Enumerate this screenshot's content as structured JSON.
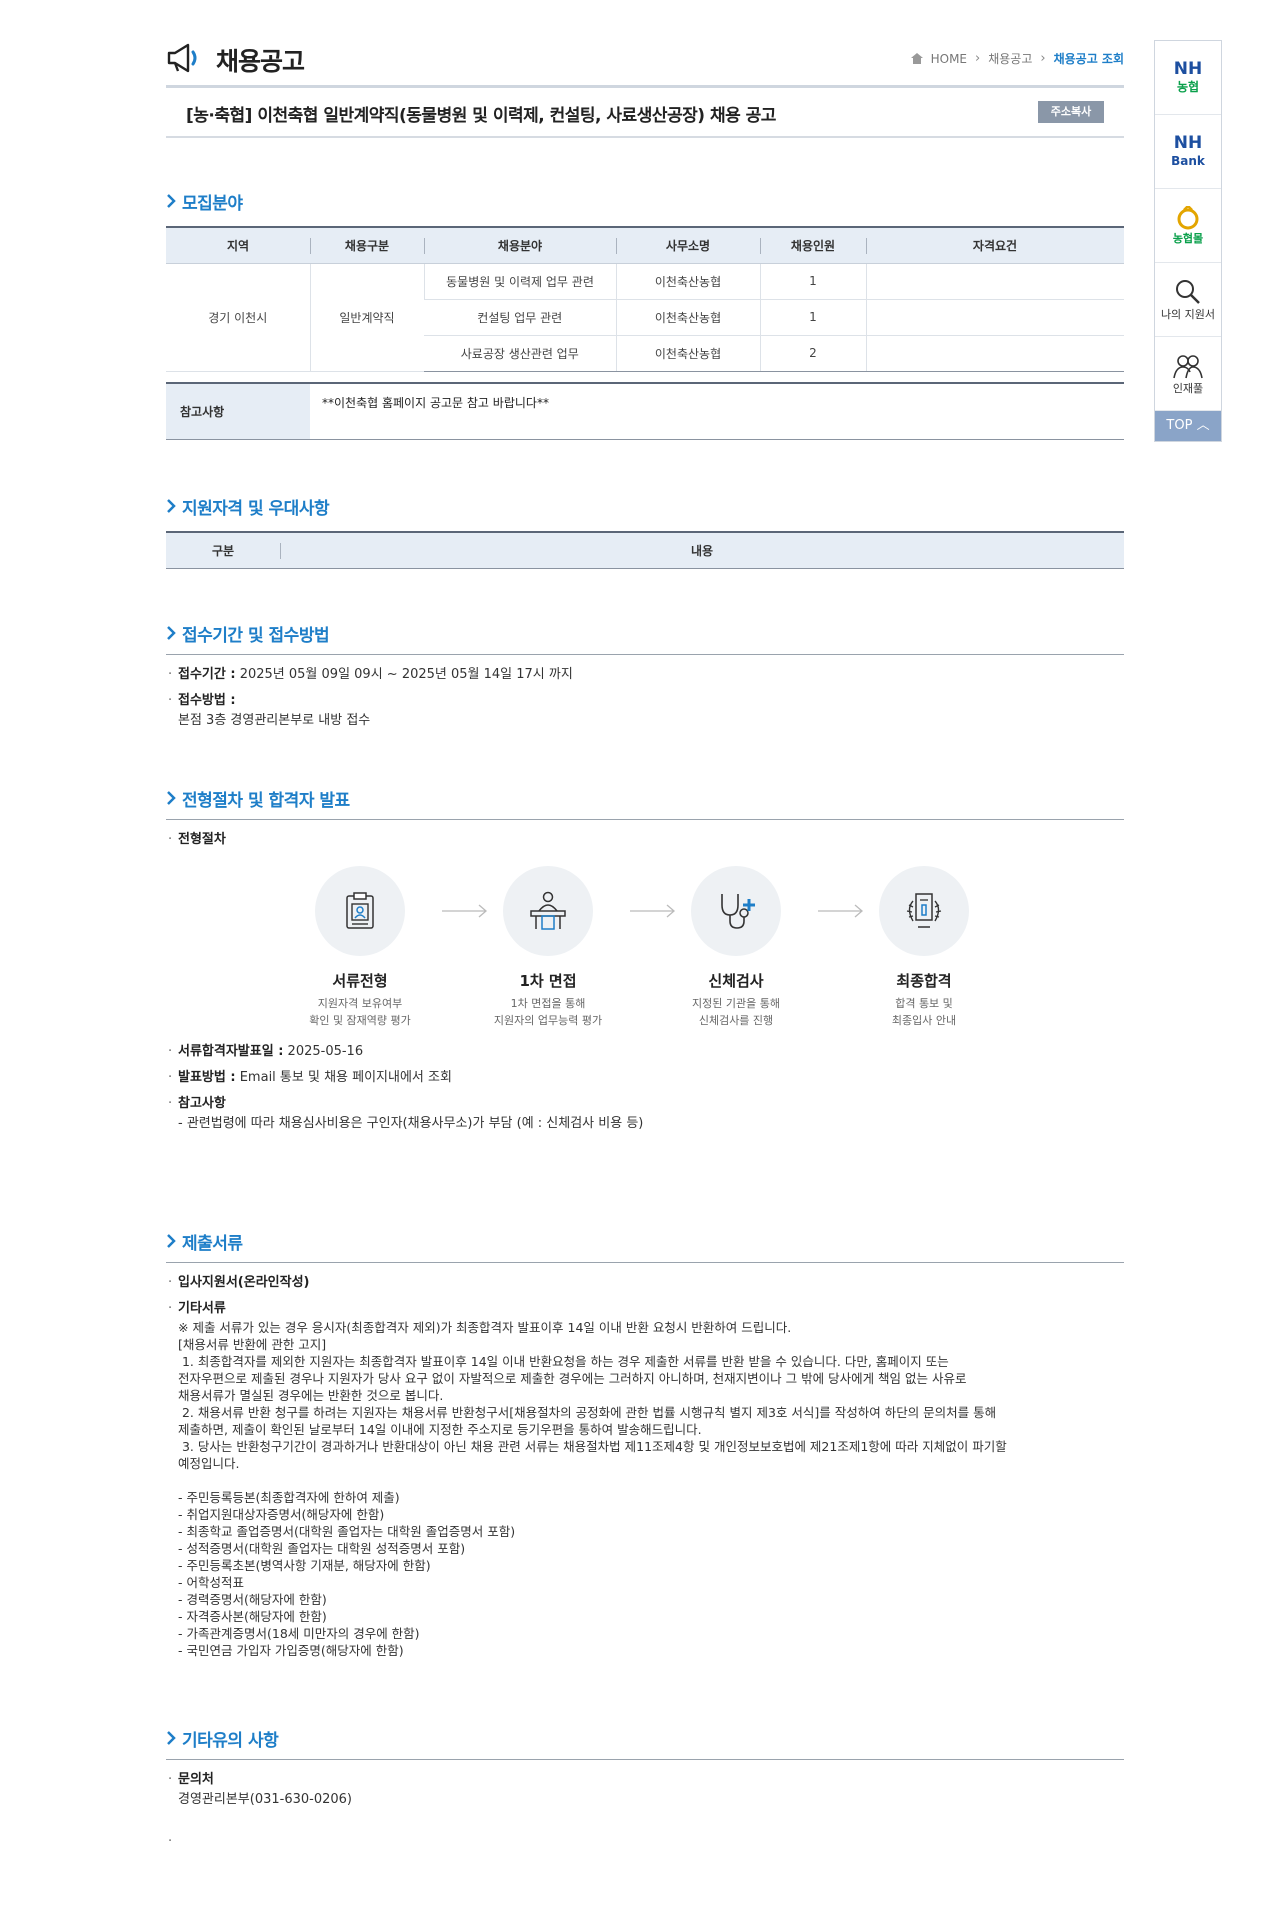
{
  "header": {
    "title": "채용공고",
    "breadcrumb": [
      "HOME",
      "채용공고",
      "채용공고 조회"
    ]
  },
  "job": {
    "title": "[농·축협] 이천축협 일반계약직(동물병원 및 이력제, 컨설팅, 사료생산공장) 채용 공고",
    "copy_label": "주소복사"
  },
  "recruit": {
    "heading": "모집분야",
    "columns": [
      "지역",
      "채용구분",
      "채용분야",
      "사무소명",
      "채용인원",
      "자격요건"
    ],
    "region": "경기 이천시",
    "type": "일반계약직",
    "rows": [
      {
        "field": "동물병원 및 이력제 업무 관련",
        "office": "이천축산농협",
        "count": "1",
        "req": ""
      },
      {
        "field": "컨설팅 업무 관련",
        "office": "이천축산농협",
        "count": "1",
        "req": ""
      },
      {
        "field": "사료공장 생산관련 업무",
        "office": "이천축산농협",
        "count": "2",
        "req": ""
      }
    ],
    "note_label": "참고사항",
    "note_value": "**이천축협 홈페이지 공고문 참고 바랍니다**"
  },
  "qualify": {
    "heading": "지원자격 및 우대사항",
    "columns": [
      "구분",
      "내용"
    ]
  },
  "apply": {
    "heading": "접수기간 및 접수방법",
    "period_label": "접수기간 :",
    "period_value": "2025년 05월 09일 09시 ~ 2025년 05월 14일 17시 까지",
    "method_label": "접수방법 :",
    "method_value": "본점 3층 경영관리본부로 내방 접수"
  },
  "process": {
    "heading": "전형절차 및 합격자 발표",
    "label": "전형절차",
    "steps": [
      {
        "title": "서류전형",
        "desc1": "지원자격 보유여부",
        "desc2": "확인 및 잠재역량 평가"
      },
      {
        "title": "1차 면접",
        "desc1": "1차 면접을 통해",
        "desc2": "지원자의 업무능력 평가"
      },
      {
        "title": "신체검사",
        "desc1": "지정된 기관을 통해",
        "desc2": "신체검사를 진행"
      },
      {
        "title": "최종합격",
        "desc1": "합격 통보 및",
        "desc2": "최종입사 안내"
      }
    ],
    "announce_label": "서류합격자발표일 :",
    "announce_value": "2025-05-16",
    "how_label": "발표방법 :",
    "how_value": "Email 통보 및 채용 페이지내에서 조회",
    "ref_label": "참고사항",
    "ref_value": "- 관련법령에 따라 채용심사비용은 구인자(채용사무소)가 부담 (예 : 신체검사 비용 등)"
  },
  "docs": {
    "heading": "제출서류",
    "item1": "입사지원서(온라인작성)",
    "item2": "기타서류",
    "text": "※ 제출 서류가 있는 경우 응시자(최종합격자 제외)가 최종합격자 발표이후 14일 이내 반환 요청시 반환하여 드립니다.\n[채용서류 반환에 관한 고지]\n 1. 최종합격자를 제외한 지원자는 최종합격자 발표이후 14일 이내 반환요청을 하는 경우 제출한 서류를 반환 받을 수 있습니다. 다만, 홈페이지 또는\n전자우편으로 제출된 경우나 지원자가 당사 요구 없이 자발적으로 제출한 경우에는 그러하지 아니하며, 천재지변이나 그 밖에 당사에게 책임 없는 사유로\n채용서류가 멸실된 경우에는 반환한 것으로 봅니다.\n 2. 채용서류 반환 청구를 하려는 지원자는 채용서류 반환청구서[채용절차의 공정화에 관한 법률 시행규칙 별지 제3호 서식]를 작성하여 하단의 문의처를 통해\n제출하면, 제출이 확인된 날로부터 14일 이내에 지정한 주소지로 등기우편을 통하여 발송해드립니다.\n 3. 당사는 반환청구기간이 경과하거나 반환대상이 아닌 채용 관련 서류는 채용절차법 제11조제4항 및 개인정보보호법에 제21조제1항에 따라 지체없이 파기할\n예정입니다.\n\n- 주민등록등본(최종합격자에 한하여 제출)\n- 취업지원대상자증명서(해당자에 한함)\n- 최종학교 졸업증명서(대학원 졸업자는 대학원 졸업증명서 포함)\n- 성적증명서(대학원 졸업자는 대학원 성적증명서 포함)\n- 주민등록초본(병역사항 기재분, 해당자에 한함)\n- 어학성적표\n- 경력증명서(해당자에 한함)\n- 자격증사본(해당자에 한함)\n- 가족관계증명서(18세 미만자의 경우에 한함)\n- 국민연금 가입자 가입증명(해당자에 한함)"
  },
  "etc": {
    "heading": "기타유의 사항",
    "contact_label": "문의처",
    "contact_value": "경영관리본부(031-630-0206)",
    "dot": "·"
  },
  "quick": {
    "nh_top": "NH",
    "nh_sub": "농협",
    "bank_top": "NH",
    "bank_sub": "Bank",
    "mall": "농협몰",
    "my": "나의 지원서",
    "pool": "인재풀",
    "top": "TOP"
  },
  "colors": {
    "accent": "#1e7ec8",
    "th_bg": "#e6edf5",
    "top_btn": "#8aa4c8"
  }
}
